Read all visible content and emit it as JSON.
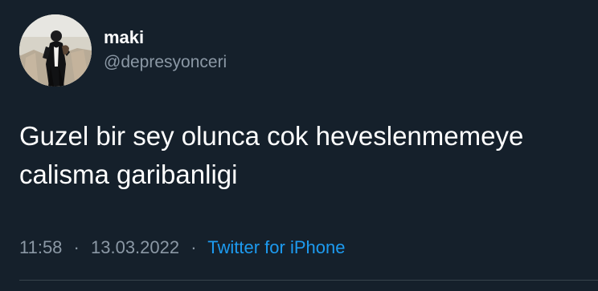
{
  "user": {
    "display_name": "maki",
    "username": "@depresyonceri"
  },
  "tweet": {
    "text": "Guzel bir sey olunca cok heveslenmemeye\ncalisma garibanligi",
    "time": "11:58",
    "date": "13.03.2022",
    "separator": "·",
    "source": "Twitter for iPhone"
  },
  "icons": {
    "avatar": "profile-photo",
    "more": "more-options-icon"
  },
  "colors": {
    "background": "#15202b",
    "primary_text": "#ffffff",
    "secondary_text": "#8b98a5",
    "link": "#1d9bf0",
    "divider": "#38444d"
  }
}
